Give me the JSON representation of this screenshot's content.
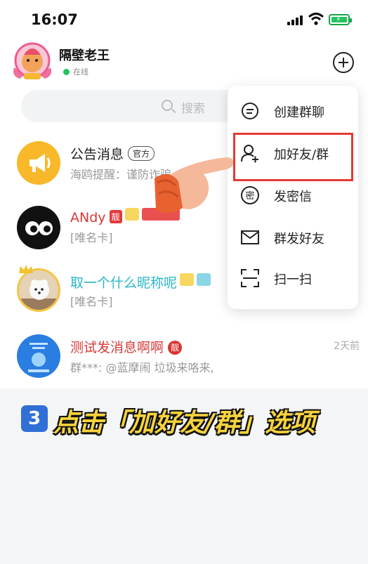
{
  "status_bar": {
    "time": "16:07"
  },
  "profile": {
    "name": "隔壁老王",
    "status": "在线"
  },
  "search": {
    "placeholder": "搜索"
  },
  "chats": [
    {
      "title": "公告消息",
      "badge": "官方",
      "preview": "海鸥提醒：谨防诈骗"
    },
    {
      "title": "ANdy",
      "badge": "靓",
      "preview": "[唯名卡]"
    },
    {
      "title": "取一个什么昵称呢",
      "preview": "[唯名卡]"
    },
    {
      "title": "测试发消息啊啊",
      "badge": "靓",
      "preview": "群***: @蓝摩闹 垃圾来咯来,",
      "time": "2天前"
    }
  ],
  "menu": {
    "items": [
      {
        "label": "创建群聊",
        "icon": "chat-bubble-icon"
      },
      {
        "label": "加好友/群",
        "icon": "add-user-icon"
      },
      {
        "label": "发密信",
        "icon": "secret-message-icon"
      },
      {
        "label": "群发好友",
        "icon": "mail-icon"
      },
      {
        "label": "扫一扫",
        "icon": "scan-icon"
      }
    ]
  },
  "caption": {
    "step": "3",
    "text": "点击「加好友/群」选项"
  },
  "colors": {
    "title_red": "#d63a3a",
    "title_cyan": "#29b6c8",
    "highlight": "#e53935",
    "caption_yellow": "#f7d33b",
    "online": "#22c55e"
  }
}
